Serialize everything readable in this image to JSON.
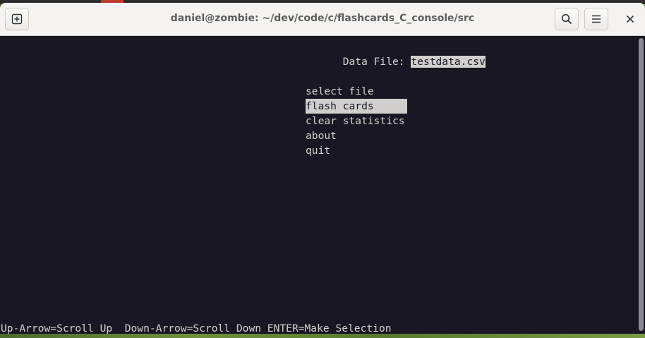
{
  "window": {
    "title": "daniel@zombie: ~/dev/code/c/flashcards_C_console/src"
  },
  "terminal": {
    "data_file_label": "Data File: ",
    "data_file_value": "testdata.csv",
    "menu": [
      {
        "label": "select file"
      },
      {
        "label": "flash cards "
      },
      {
        "label": "clear statistics"
      },
      {
        "label": "about"
      },
      {
        "label": "quit"
      }
    ],
    "selected_index": 1,
    "status_line": "Up-Arrow=Scroll Up  Down-Arrow=Scroll Down ENTER=Make Selection"
  },
  "icons": {
    "new_tab": "new-tab-icon",
    "search": "search-icon",
    "menu": "hamburger-menu-icon",
    "close": "close-icon"
  },
  "colors": {
    "terminal_bg": "#181723",
    "terminal_fg": "#d4d2cf",
    "selection_bg": "#d0cfcd",
    "titlebar_bg": "#f4f3f2"
  }
}
